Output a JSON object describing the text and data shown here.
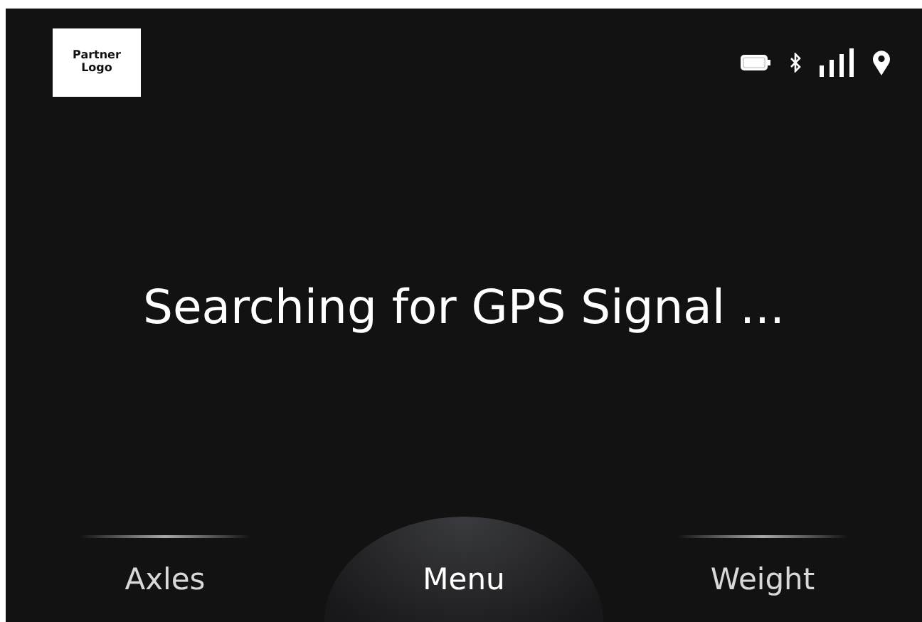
{
  "header": {
    "logo": [
      "Partner",
      "Logo"
    ]
  },
  "message": "Searching for GPS Signal ...",
  "nav": [
    {
      "label": "Axles",
      "selected": false
    },
    {
      "label": "Menu",
      "selected": true
    },
    {
      "label": "Weight",
      "selected": false
    }
  ]
}
